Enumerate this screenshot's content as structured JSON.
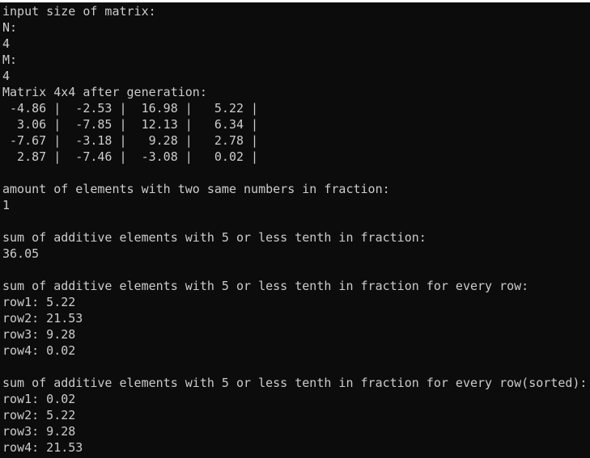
{
  "console": {
    "lines": [
      "input size of matrix:",
      "N:",
      "4",
      "M:",
      "4",
      "Matrix 4x4 after generation:",
      " -4.86 |  -2.53 |  16.98 |   5.22 |",
      "  3.06 |  -7.85 |  12.13 |   6.34 |",
      " -7.67 |  -3.18 |   9.28 |   2.78 |",
      "  2.87 |  -7.46 |  -3.08 |   0.02 |",
      "",
      "amount of elements with two same numbers in fraction:",
      "1",
      "",
      "sum of additive elements with 5 or less tenth in fraction:",
      "36.05",
      "",
      "sum of additive elements with 5 or less tenth in fraction for every row:",
      "row1: 5.22",
      "row2: 21.53",
      "row3: 9.28",
      "row4: 0.02",
      "",
      "sum of additive elements with 5 or less tenth in fraction for every row(sorted):",
      "row1: 0.02",
      "row2: 5.22",
      "row3: 9.28",
      "row4: 21.53"
    ]
  }
}
